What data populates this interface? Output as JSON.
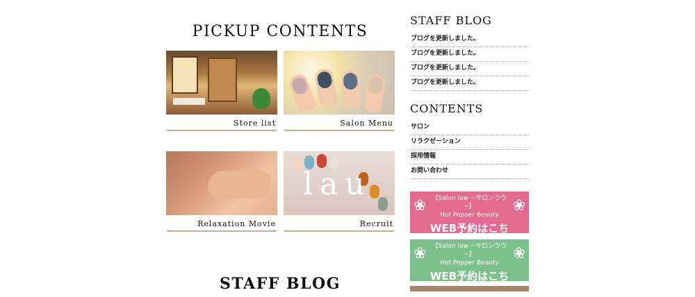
{
  "main": {
    "pickup_title": "PICKUP CONTENTS",
    "cards": [
      {
        "label": "Store list"
      },
      {
        "label": "Salon Menu"
      },
      {
        "label": "Relaxation Movie"
      },
      {
        "label": "Recruit"
      }
    ],
    "recruit_logo": "lau",
    "staff_blog_title": "STAFF BLOG"
  },
  "sidebar": {
    "staff_blog_heading": "STAFF BLOG",
    "blog_items": [
      "ブログを更新しました。",
      "ブログを更新しました。",
      "ブログを更新しました。",
      "ブログを更新しました。"
    ],
    "contents_heading": "CONTENTS",
    "content_items": [
      "サロン",
      "リラクゼーション",
      "採用情報",
      "お問い合わせ"
    ],
    "banners": [
      {
        "line1": "【Salon law ~サロンラウ~】",
        "line2": "Hot Pepper Beauty",
        "cta": "WEB予約はこちら",
        "color": "#e26b8f"
      },
      {
        "line1": "【Salon law ~サロンラウ~】",
        "line2": "Hot Pepper Beauty",
        "cta": "WEB予約はこちら",
        "color": "#7cc08c"
      }
    ]
  }
}
